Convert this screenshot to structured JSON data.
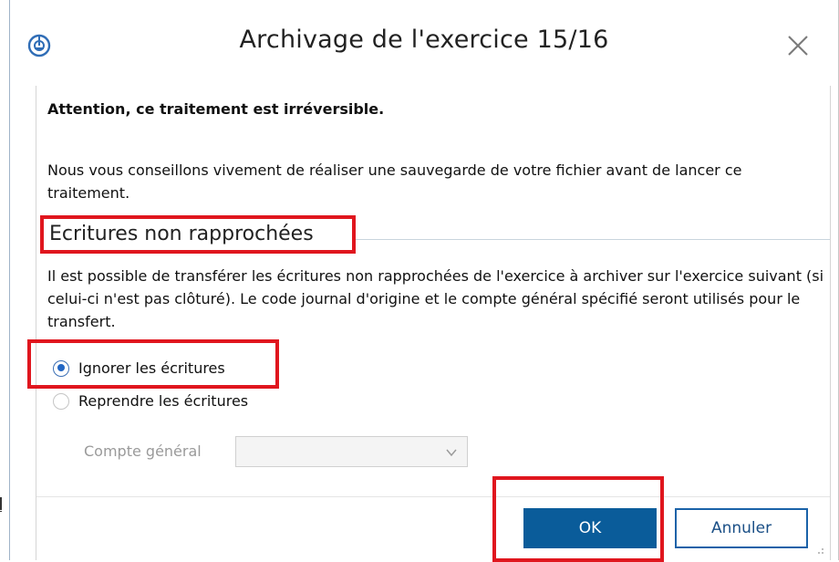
{
  "window": {
    "title": "Archivage de l'exercice 15/16"
  },
  "content": {
    "warning": "Attention, ce traitement est irréversible.",
    "advice": "Nous vous conseillons vivement de réaliser une sauvegarde de votre fichier avant de lancer ce traitement.",
    "section_title": "Ecritures non rapprochées",
    "description": "Il est possible de transférer les écritures non rapprochées de l'exercice à archiver sur l'exercice suivant (si celui-ci n'est pas clôturé). Le code journal d'origine et le compte général spécifié seront utilisés pour le transfert.",
    "options": [
      {
        "label": "Ignorer les écritures",
        "checked": true
      },
      {
        "label": "Reprendre les écritures",
        "checked": false
      }
    ],
    "compte_label": "Compte général",
    "compte_value": ""
  },
  "footer": {
    "ok_label": "OK",
    "cancel_label": "Annuler"
  },
  "colors": {
    "accent": "#0a5c9a",
    "highlight": "#e0161e"
  },
  "icons": {
    "app": "app-logo-icon",
    "close": "close-icon",
    "dropdown": "chevron-down-icon",
    "resize": "resize-grip-icon"
  }
}
